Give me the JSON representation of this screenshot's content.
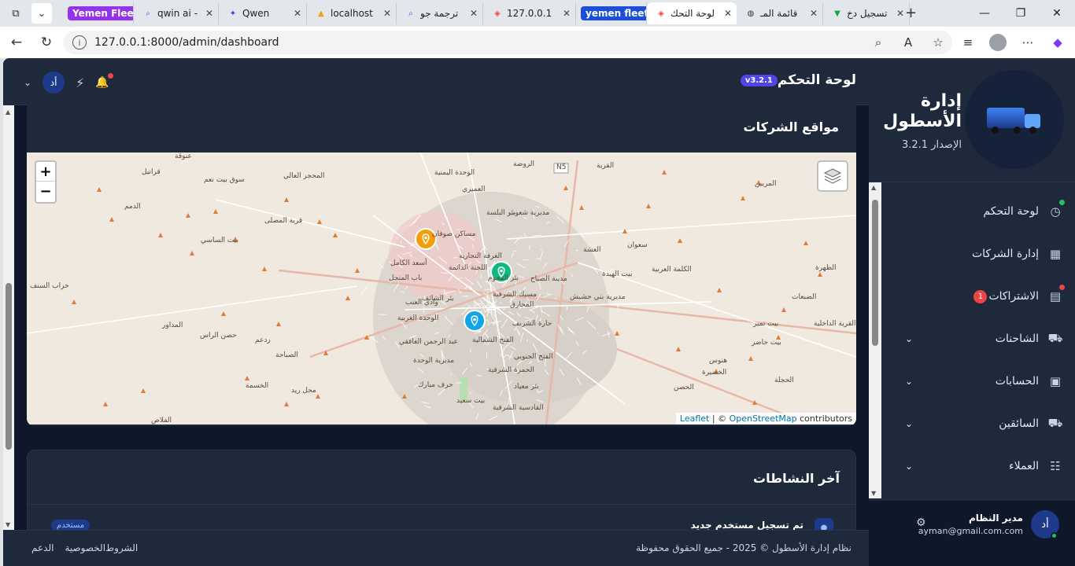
{
  "browser": {
    "tabs": [
      {
        "label": "Yemen Fleet",
        "type": "group",
        "color": "#9333ea"
      },
      {
        "label": "qwin ai -",
        "icon": "search-icon"
      },
      {
        "label": "Qwen",
        "icon": "qwen-icon"
      },
      {
        "label": "localhost",
        "icon": "pma-icon"
      },
      {
        "label": "ترجمة جو",
        "icon": "search-icon"
      },
      {
        "label": "127.0.0.1",
        "icon": "laravel-icon"
      },
      {
        "label": "yemen fleet2",
        "type": "group",
        "color": "#1d4ed8"
      },
      {
        "label": "لوحة التحك",
        "icon": "laravel-icon",
        "active": true
      },
      {
        "label": "قائمة المـ",
        "icon": "globe-icon"
      },
      {
        "label": "تسجيل دخ",
        "icon": "vue-icon"
      }
    ],
    "url": "127.0.0.1:8000/admin/dashboard"
  },
  "sidebar": {
    "brand_title": "إدارة الأسطول",
    "brand_version": "الإصدار 3.2.1",
    "items": [
      {
        "label": "لوحة التحكم",
        "icon": "dashboard-icon",
        "dot": "#22c55e"
      },
      {
        "label": "إدارة الشركات",
        "icon": "building-icon"
      },
      {
        "label": "الاشتراكات",
        "icon": "document-icon",
        "badge": "1",
        "dot": "#ef4444"
      },
      {
        "label": "الشاحنات",
        "icon": "truck-icon",
        "expandable": true
      },
      {
        "label": "الحسابات",
        "icon": "chip-icon",
        "expandable": true
      },
      {
        "label": "السائقين",
        "icon": "truck-icon",
        "expandable": true
      },
      {
        "label": "العملاء",
        "icon": "users-icon",
        "expandable": true
      }
    ],
    "user": {
      "avatar": "أد",
      "name": "مدير النظام",
      "email": "ayman@gmail.com.com"
    }
  },
  "topbar": {
    "title": "لوحة التحكم",
    "version": "v3.2.1",
    "avatar": "أد"
  },
  "map_card": {
    "title": "مواقع الشركات",
    "zoom_in": "+",
    "zoom_out": "−",
    "attribution_leaflet": "Leaflet",
    "attribution_sep": " | © ",
    "attribution_osm": "OpenStreetMap",
    "attribution_tail": " contributors",
    "labels": [
      "الروضة",
      "الوحدة اليمنية",
      "العميري",
      "بئر البلسة",
      "مساكن صوفان",
      "الغرفة التجارية",
      "اللجنة الدائمة",
      "بئر الفحوم",
      "مدينة الصباح",
      "باب المنجل",
      "أسعد الكامل",
      "وادي العنب",
      "بئر الشائف",
      "الوحدة الغربية",
      "مسيك الشرقية",
      "المحارق",
      "حارة الشريف",
      "عبد الرحمن الغافقي",
      "الفتح الشمالية",
      "الفتح الجنوبي",
      "مديرية الوحدة",
      "الحمرة الشرقية",
      "حرف مبارك",
      "بئر معياد",
      "القادسية الشرقية",
      "بيت سعيد",
      "القرية",
      "المحجر العالي",
      "قرية المصلى",
      "بيت الساسي",
      "خراب السنف",
      "سوق بيت نعم",
      "الدمم",
      "قرانيل",
      "عنوقة",
      "حصن الراس",
      "ردعم",
      "المداور",
      "الصباحة",
      "الخسمة",
      "محل ريد",
      "الفلاص",
      "العشة",
      "سعوان",
      "بيت الهيدة",
      "الكلمة العربية",
      "مديرية بني حشيش",
      "الظهرة",
      "الضبعات",
      "بيت تمير",
      "بيت حاضر",
      "هنوس",
      "الحجلة",
      "الحصن",
      "الخضيرة",
      "القرية الداخلية",
      "المربين",
      "مديرية شعوب",
      "N5"
    ],
    "markers": [
      {
        "name": "orange-marker",
        "color": "#f59e0b"
      },
      {
        "name": "green-marker",
        "color": "#10b981"
      },
      {
        "name": "blue-marker",
        "color": "#0ea5e9"
      }
    ]
  },
  "activity_card": {
    "title": "آخر النشاطات",
    "item_title": "تم تسجيل مستخدم جديد",
    "item_badge": "مستخدم"
  },
  "footer": {
    "copyright": "نظام إدارة الأسطول © 2025 - جميع الحقوق محفوظة",
    "links": [
      "الشروط",
      "الخصوصية",
      "الدعم"
    ]
  }
}
